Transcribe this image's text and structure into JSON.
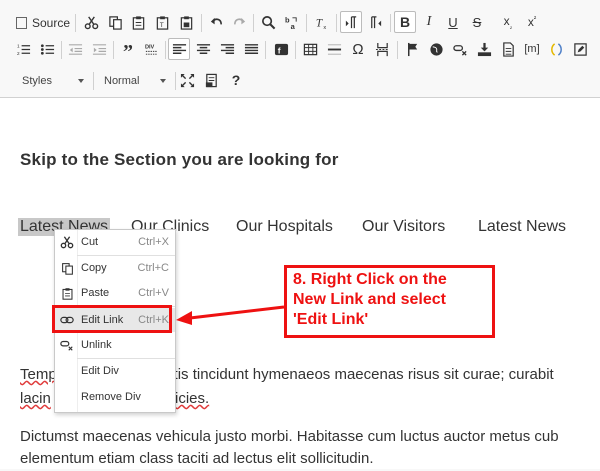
{
  "toolbar": {
    "source_label": "Source",
    "styles_label": "Styles",
    "format_label": "Normal"
  },
  "content": {
    "heading": "Skip to the Section you are looking for",
    "nav": [
      "Latest News",
      "Our Clinics",
      "Our Hospitals",
      "Our Visitors",
      "Latest News"
    ],
    "para1_line1": [
      "Temp",
      "gittis tincidunt hymenaeos maecenas risus sit curae; curabit"
    ],
    "para1_line2": [
      "lacin",
      "tricies."
    ],
    "para2_line1": "Dictumst maecenas vehicula justo morbi. Habitasse cum luctus auctor metus cub",
    "para2_line2": "elementum etiam class taciti ad lectus elit sollicitudin."
  },
  "context_menu": {
    "items": [
      {
        "label": "Cut",
        "shortcut": "Ctrl+X",
        "icon": "cut-icon"
      },
      {
        "label": "Copy",
        "shortcut": "Ctrl+C",
        "icon": "copy-icon"
      },
      {
        "label": "Paste",
        "shortcut": "Ctrl+V",
        "icon": "paste-icon"
      },
      {
        "label": "Edit Link",
        "shortcut": "Ctrl+K",
        "icon": "link-icon"
      },
      {
        "label": "Unlink",
        "shortcut": "",
        "icon": "unlink-icon"
      },
      {
        "label": "Edit Div",
        "shortcut": "",
        "icon": ""
      },
      {
        "label": "Remove Div",
        "shortcut": "",
        "icon": ""
      }
    ]
  },
  "annotation": {
    "text": "8. Right Click on the New Link and select 'Edit Link'",
    "line1": "8. Right Click on the",
    "line2": "New Link and select",
    "line3": "'Edit Link'",
    "color": "#e11111"
  }
}
